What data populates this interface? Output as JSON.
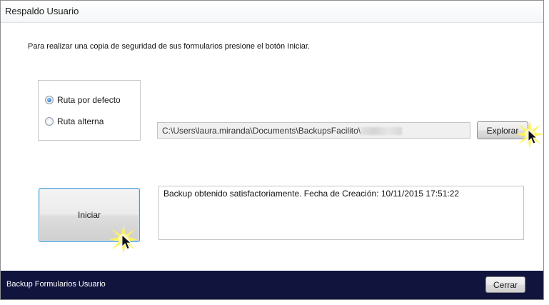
{
  "window": {
    "title": "Respaldo Usuario"
  },
  "main": {
    "instruction": "Para realizar una copia de seguridad de sus formularios presione el botón Iniciar.",
    "route_options": [
      {
        "label": "Ruta por defecto",
        "checked": true
      },
      {
        "label": "Ruta alterna",
        "checked": false
      }
    ],
    "path_value": "C:\\Users\\laura.miranda\\Documents\\BackupsFacilito\\",
    "browse_label": "Explorar",
    "start_label": "Iniciar",
    "status_message": "Backup obtenido satisfactoriamente.  Fecha de Creación: 10/11/2015 17:51:22"
  },
  "footer": {
    "label": "Backup Formularios Usuario",
    "close_label": "Cerrar",
    "background_color": "#11143d"
  },
  "icons": [
    "cursor-highlight-icon"
  ]
}
